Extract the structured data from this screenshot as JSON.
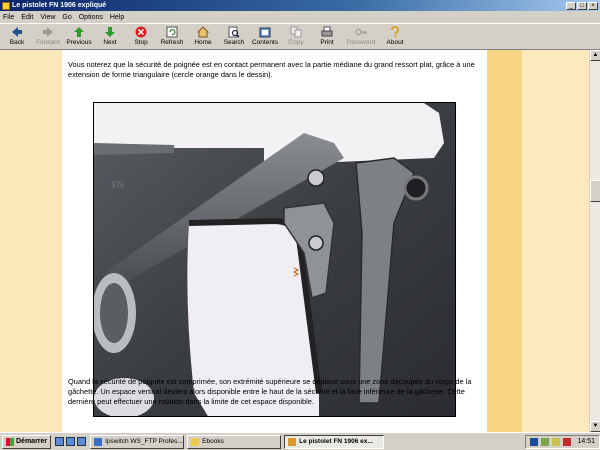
{
  "window": {
    "title": "Le pistolet FN 1906 expliqué"
  },
  "menu": [
    "File",
    "Edit",
    "View",
    "Go",
    "Options",
    "Help"
  ],
  "toolbar": [
    {
      "label": "Back",
      "icon": "back-arrow-icon",
      "enabled": true
    },
    {
      "label": "Forward",
      "icon": "forward-arrow-icon",
      "enabled": false
    },
    {
      "label": "Previous",
      "icon": "up-arrow-icon",
      "enabled": true
    },
    {
      "label": "Next",
      "icon": "down-arrow-icon",
      "enabled": true
    },
    {
      "label": "Stop",
      "icon": "stop-icon",
      "enabled": true
    },
    {
      "label": "Refresh",
      "icon": "refresh-icon",
      "enabled": true
    },
    {
      "label": "Home",
      "icon": "home-icon",
      "enabled": true
    },
    {
      "label": "Search",
      "icon": "search-icon",
      "enabled": true
    },
    {
      "label": "Contents",
      "icon": "contents-icon",
      "enabled": true
    },
    {
      "label": "Copy",
      "icon": "copy-icon",
      "enabled": false
    },
    {
      "label": "Print",
      "icon": "print-icon",
      "enabled": true
    },
    {
      "label": "Password",
      "icon": "key-icon",
      "enabled": false
    },
    {
      "label": "About",
      "icon": "about-icon",
      "enabled": true
    }
  ],
  "content": {
    "paragraph1": "Vous noterez que la sécurité de poignée est en contact permanent avec la partie médiane du grand ressort plat, grâce à une extension de forme triangulaire (cercle orange dans le dessin).",
    "paragraph2": "Quand la sécurité de poignée est comprimée, son extrémité supérieure se déplace sous une zone découpée du corps de la gâchette. Un espace vertical devient alors disponible entre le haut de la sécurité et la face inférieure de la gâchette. Cette dernière peut effectuer une rotation dans la limite de cet espace disponible."
  },
  "taskbar": {
    "start_label": "Démarrer",
    "tasks": [
      {
        "label": "Ipswitch WS_FTP Profes...",
        "active": false
      },
      {
        "label": "Ebooks",
        "active": false
      },
      {
        "label": "Le pistolet FN 1906 ex...",
        "active": true
      }
    ],
    "clock": "14:51"
  },
  "colors": {
    "page_bg": "#ffffff",
    "gutter_left": "#fbe8b8",
    "gutter_right_stripe": "#f8d582",
    "gutter_right": "#fce9bd",
    "titlebar": "#0a246a"
  }
}
